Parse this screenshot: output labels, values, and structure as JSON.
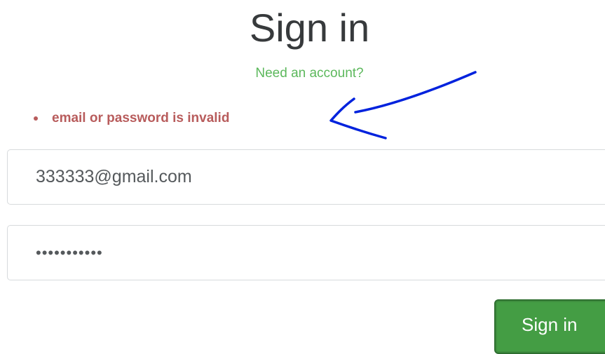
{
  "page": {
    "title": "Sign in",
    "account_link": "Need an account?"
  },
  "errors": [
    "email or password is invalid"
  ],
  "form": {
    "email_value": "333333@gmail.com",
    "password_value": "•••••••••••",
    "submit_label": "Sign in"
  },
  "colors": {
    "link": "#5cb85c",
    "error": "#b85c5c",
    "button": "#449d44",
    "annotation": "#0022dd"
  },
  "annotation": {
    "icon": "hand-drawn-arrow-icon"
  }
}
